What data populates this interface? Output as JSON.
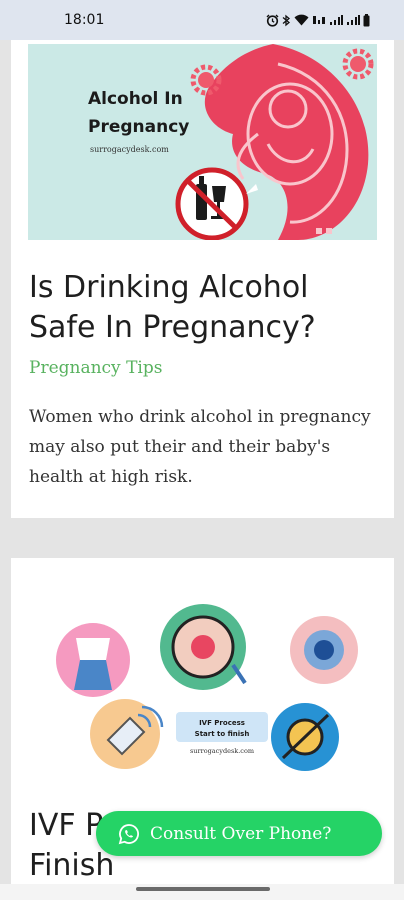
{
  "status_bar": {
    "time": "18:01",
    "icons": [
      "alarm-icon",
      "bluetooth-icon",
      "wifi-icon",
      "volte-icon",
      "signal-icon",
      "signal-icon",
      "battery-icon"
    ]
  },
  "articles": [
    {
      "image_text": {
        "headline_line1": "Alcohol In",
        "headline_line2": "Pregnancy",
        "site": "surrogacydesk.com"
      },
      "title": "Is Drinking Alcohol Safe In Pregnancy?",
      "category": "Pregnancy Tips",
      "excerpt": "Women who drink alcohol in pregnancy may also put their and their baby's health at high risk."
    },
    {
      "image_text": {
        "label_line1": "IVF Process",
        "label_line2": "Start to finish",
        "site": "surrogacydesk.com"
      },
      "title": "IVF Process Start To Finish"
    }
  ],
  "consult_button": {
    "label": "Consult Over Phone?",
    "icon": "whatsapp-icon"
  },
  "colors": {
    "accent_green": "#58b25f",
    "whatsapp_green": "#25d366",
    "image_bg": "#cbe9e6",
    "uterus_red": "#e8425e"
  }
}
